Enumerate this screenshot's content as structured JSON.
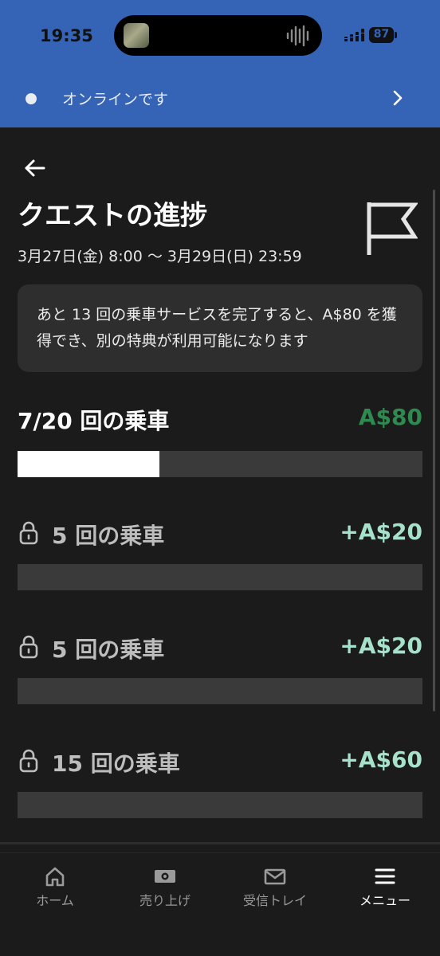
{
  "status_bar": {
    "time": "19:35",
    "battery": "87"
  },
  "online_banner": {
    "text": "オンラインです"
  },
  "quest": {
    "title": "クエストの進捗",
    "date_range": "3月27日(金) 8:00 〜 3月29日(日) 23:59",
    "info": "あと 13 回の乗車サービスを完了すると、A$80 を獲得でき、別の特典が利用可能になります"
  },
  "current": {
    "label": "7/20 回の乗車",
    "amount": "A$80",
    "progress_fraction": 0.35
  },
  "tiers": [
    {
      "label": "5 回の乗車",
      "amount": "+A$20",
      "locked": true
    },
    {
      "label": "5 回の乗車",
      "amount": "+A$20",
      "locked": true
    },
    {
      "label": "15 回の乗車",
      "amount": "+A$60",
      "locked": true
    }
  ],
  "nav": [
    {
      "label": "ホーム",
      "icon": "home-icon"
    },
    {
      "label": "売り上げ",
      "icon": "earnings-icon"
    },
    {
      "label": "受信トレイ",
      "icon": "inbox-icon"
    },
    {
      "label": "メニュー",
      "icon": "menu-icon",
      "active": true
    }
  ],
  "colors": {
    "header_blue": "#3563b5",
    "background": "#1b1b1b",
    "main_amount_green": "#2f8a4f",
    "tier_amount_mint": "#a6e1cc"
  }
}
